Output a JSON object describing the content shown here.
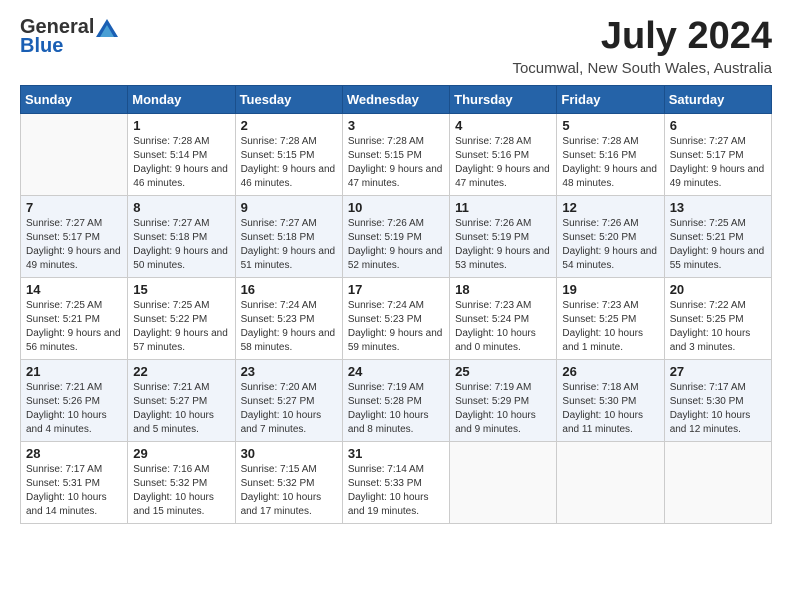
{
  "header": {
    "logo_general": "General",
    "logo_blue": "Blue",
    "title": "July 2024",
    "subtitle": "Tocumwal, New South Wales, Australia"
  },
  "weekdays": [
    "Sunday",
    "Monday",
    "Tuesday",
    "Wednesday",
    "Thursday",
    "Friday",
    "Saturday"
  ],
  "weeks": [
    [
      {
        "day": "",
        "sunrise": "",
        "sunset": "",
        "daylight": ""
      },
      {
        "day": "1",
        "sunrise": "Sunrise: 7:28 AM",
        "sunset": "Sunset: 5:14 PM",
        "daylight": "Daylight: 9 hours and 46 minutes."
      },
      {
        "day": "2",
        "sunrise": "Sunrise: 7:28 AM",
        "sunset": "Sunset: 5:15 PM",
        "daylight": "Daylight: 9 hours and 46 minutes."
      },
      {
        "day": "3",
        "sunrise": "Sunrise: 7:28 AM",
        "sunset": "Sunset: 5:15 PM",
        "daylight": "Daylight: 9 hours and 47 minutes."
      },
      {
        "day": "4",
        "sunrise": "Sunrise: 7:28 AM",
        "sunset": "Sunset: 5:16 PM",
        "daylight": "Daylight: 9 hours and 47 minutes."
      },
      {
        "day": "5",
        "sunrise": "Sunrise: 7:28 AM",
        "sunset": "Sunset: 5:16 PM",
        "daylight": "Daylight: 9 hours and 48 minutes."
      },
      {
        "day": "6",
        "sunrise": "Sunrise: 7:27 AM",
        "sunset": "Sunset: 5:17 PM",
        "daylight": "Daylight: 9 hours and 49 minutes."
      }
    ],
    [
      {
        "day": "7",
        "sunrise": "Sunrise: 7:27 AM",
        "sunset": "Sunset: 5:17 PM",
        "daylight": "Daylight: 9 hours and 49 minutes."
      },
      {
        "day": "8",
        "sunrise": "Sunrise: 7:27 AM",
        "sunset": "Sunset: 5:18 PM",
        "daylight": "Daylight: 9 hours and 50 minutes."
      },
      {
        "day": "9",
        "sunrise": "Sunrise: 7:27 AM",
        "sunset": "Sunset: 5:18 PM",
        "daylight": "Daylight: 9 hours and 51 minutes."
      },
      {
        "day": "10",
        "sunrise": "Sunrise: 7:26 AM",
        "sunset": "Sunset: 5:19 PM",
        "daylight": "Daylight: 9 hours and 52 minutes."
      },
      {
        "day": "11",
        "sunrise": "Sunrise: 7:26 AM",
        "sunset": "Sunset: 5:19 PM",
        "daylight": "Daylight: 9 hours and 53 minutes."
      },
      {
        "day": "12",
        "sunrise": "Sunrise: 7:26 AM",
        "sunset": "Sunset: 5:20 PM",
        "daylight": "Daylight: 9 hours and 54 minutes."
      },
      {
        "day": "13",
        "sunrise": "Sunrise: 7:25 AM",
        "sunset": "Sunset: 5:21 PM",
        "daylight": "Daylight: 9 hours and 55 minutes."
      }
    ],
    [
      {
        "day": "14",
        "sunrise": "Sunrise: 7:25 AM",
        "sunset": "Sunset: 5:21 PM",
        "daylight": "Daylight: 9 hours and 56 minutes."
      },
      {
        "day": "15",
        "sunrise": "Sunrise: 7:25 AM",
        "sunset": "Sunset: 5:22 PM",
        "daylight": "Daylight: 9 hours and 57 minutes."
      },
      {
        "day": "16",
        "sunrise": "Sunrise: 7:24 AM",
        "sunset": "Sunset: 5:23 PM",
        "daylight": "Daylight: 9 hours and 58 minutes."
      },
      {
        "day": "17",
        "sunrise": "Sunrise: 7:24 AM",
        "sunset": "Sunset: 5:23 PM",
        "daylight": "Daylight: 9 hours and 59 minutes."
      },
      {
        "day": "18",
        "sunrise": "Sunrise: 7:23 AM",
        "sunset": "Sunset: 5:24 PM",
        "daylight": "Daylight: 10 hours and 0 minutes."
      },
      {
        "day": "19",
        "sunrise": "Sunrise: 7:23 AM",
        "sunset": "Sunset: 5:25 PM",
        "daylight": "Daylight: 10 hours and 1 minute."
      },
      {
        "day": "20",
        "sunrise": "Sunrise: 7:22 AM",
        "sunset": "Sunset: 5:25 PM",
        "daylight": "Daylight: 10 hours and 3 minutes."
      }
    ],
    [
      {
        "day": "21",
        "sunrise": "Sunrise: 7:21 AM",
        "sunset": "Sunset: 5:26 PM",
        "daylight": "Daylight: 10 hours and 4 minutes."
      },
      {
        "day": "22",
        "sunrise": "Sunrise: 7:21 AM",
        "sunset": "Sunset: 5:27 PM",
        "daylight": "Daylight: 10 hours and 5 minutes."
      },
      {
        "day": "23",
        "sunrise": "Sunrise: 7:20 AM",
        "sunset": "Sunset: 5:27 PM",
        "daylight": "Daylight: 10 hours and 7 minutes."
      },
      {
        "day": "24",
        "sunrise": "Sunrise: 7:19 AM",
        "sunset": "Sunset: 5:28 PM",
        "daylight": "Daylight: 10 hours and 8 minutes."
      },
      {
        "day": "25",
        "sunrise": "Sunrise: 7:19 AM",
        "sunset": "Sunset: 5:29 PM",
        "daylight": "Daylight: 10 hours and 9 minutes."
      },
      {
        "day": "26",
        "sunrise": "Sunrise: 7:18 AM",
        "sunset": "Sunset: 5:30 PM",
        "daylight": "Daylight: 10 hours and 11 minutes."
      },
      {
        "day": "27",
        "sunrise": "Sunrise: 7:17 AM",
        "sunset": "Sunset: 5:30 PM",
        "daylight": "Daylight: 10 hours and 12 minutes."
      }
    ],
    [
      {
        "day": "28",
        "sunrise": "Sunrise: 7:17 AM",
        "sunset": "Sunset: 5:31 PM",
        "daylight": "Daylight: 10 hours and 14 minutes."
      },
      {
        "day": "29",
        "sunrise": "Sunrise: 7:16 AM",
        "sunset": "Sunset: 5:32 PM",
        "daylight": "Daylight: 10 hours and 15 minutes."
      },
      {
        "day": "30",
        "sunrise": "Sunrise: 7:15 AM",
        "sunset": "Sunset: 5:32 PM",
        "daylight": "Daylight: 10 hours and 17 minutes."
      },
      {
        "day": "31",
        "sunrise": "Sunrise: 7:14 AM",
        "sunset": "Sunset: 5:33 PM",
        "daylight": "Daylight: 10 hours and 19 minutes."
      },
      {
        "day": "",
        "sunrise": "",
        "sunset": "",
        "daylight": ""
      },
      {
        "day": "",
        "sunrise": "",
        "sunset": "",
        "daylight": ""
      },
      {
        "day": "",
        "sunrise": "",
        "sunset": "",
        "daylight": ""
      }
    ]
  ]
}
